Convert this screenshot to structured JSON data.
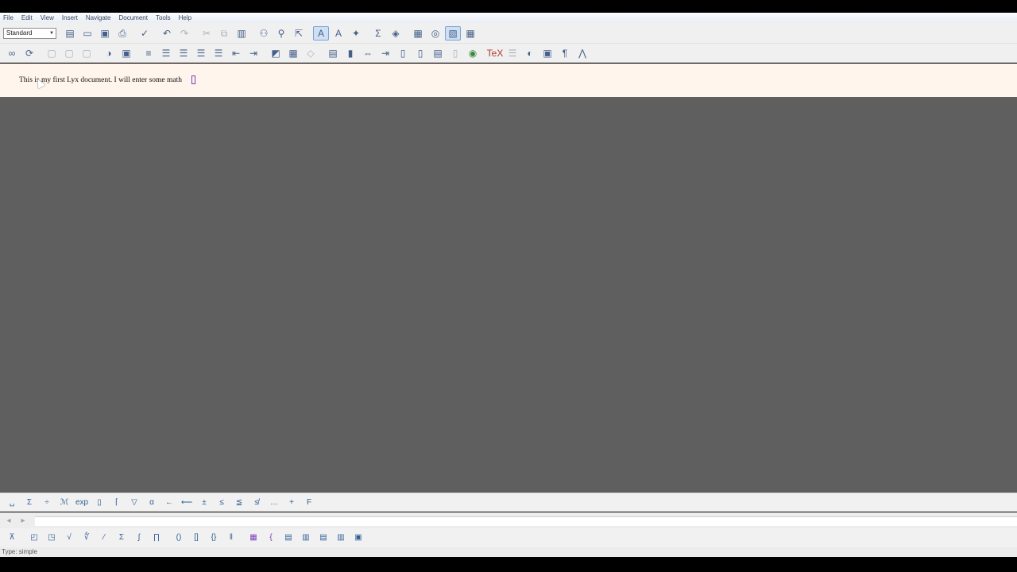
{
  "menubar": {
    "items": [
      "File",
      "Edit",
      "View",
      "Insert",
      "Navigate",
      "Document",
      "Tools",
      "Help"
    ]
  },
  "toolbar1": {
    "layout_select_value": "Standard",
    "icons": [
      {
        "name": "new-document-icon",
        "glyph": "▤"
      },
      {
        "name": "open-icon",
        "glyph": "▭"
      },
      {
        "name": "save-icon",
        "glyph": "▣"
      },
      {
        "name": "print-icon",
        "glyph": "⎙"
      },
      {
        "name": "spellcheck-icon",
        "glyph": "✓"
      },
      {
        "name": "undo-icon",
        "glyph": "↶"
      },
      {
        "name": "redo-icon",
        "glyph": "↷"
      },
      {
        "name": "cut-icon",
        "glyph": "✂"
      },
      {
        "name": "copy-icon",
        "glyph": "⧉"
      },
      {
        "name": "paste-icon",
        "glyph": "▥"
      },
      {
        "name": "find-replace-icon",
        "glyph": "⚇"
      },
      {
        "name": "search-icon",
        "glyph": "⚲"
      },
      {
        "name": "navigate-icon",
        "glyph": "⇱"
      },
      {
        "name": "text-style-icon",
        "glyph": "A"
      },
      {
        "name": "font-icon",
        "glyph": "A"
      },
      {
        "name": "emphasis-icon",
        "glyph": "✦"
      },
      {
        "name": "math-icon",
        "glyph": "Σ"
      },
      {
        "name": "insert-graphics-icon",
        "glyph": "◈"
      },
      {
        "name": "insert-table-icon",
        "glyph": "▦"
      },
      {
        "name": "view-source-icon",
        "glyph": "◎"
      },
      {
        "name": "toggle-math-toolbar-icon",
        "glyph": "▧"
      },
      {
        "name": "toggle-table-toolbar-icon",
        "glyph": "▦"
      }
    ]
  },
  "toolbar2": {
    "icons": [
      {
        "name": "view-icon",
        "glyph": "∞"
      },
      {
        "name": "update-icon",
        "glyph": "⟳"
      },
      {
        "name": "view-pdf-icon",
        "glyph": "▢"
      },
      {
        "name": "view-dvi-icon",
        "glyph": "▢"
      },
      {
        "name": "view-ps-icon",
        "glyph": "▢"
      },
      {
        "name": "change-tracking-icon",
        "glyph": "◑"
      },
      {
        "name": "review-icon",
        "glyph": "▣"
      },
      {
        "name": "align-default-icon",
        "glyph": "≡"
      },
      {
        "name": "itemize-icon",
        "glyph": "☰"
      },
      {
        "name": "enumerate-icon",
        "glyph": "☰"
      },
      {
        "name": "description-icon",
        "glyph": "☰"
      },
      {
        "name": "list-icon",
        "glyph": "☰"
      },
      {
        "name": "decrease-depth-icon",
        "glyph": "⇤"
      },
      {
        "name": "increase-depth-icon",
        "glyph": "⇥"
      },
      {
        "name": "insert-figure-icon",
        "glyph": "◩"
      },
      {
        "name": "insert-table-float-icon",
        "glyph": "▦"
      },
      {
        "name": "insert-label-icon",
        "glyph": "◇"
      },
      {
        "name": "insert-reference-icon",
        "glyph": "▤"
      },
      {
        "name": "insert-bookmark-icon",
        "glyph": "▮"
      },
      {
        "name": "insert-hyperlink-icon",
        "glyph": "⇔"
      },
      {
        "name": "insert-cross-ref-icon",
        "glyph": "⇥"
      },
      {
        "name": "insert-footnote-icon",
        "glyph": "▯"
      },
      {
        "name": "insert-margin-note-icon",
        "glyph": "▯"
      },
      {
        "name": "insert-note-icon",
        "glyph": "▤"
      },
      {
        "name": "insert-box-icon",
        "glyph": "▯"
      },
      {
        "name": "insert-url-icon",
        "glyph": "◉"
      },
      {
        "name": "insert-tex-code-icon",
        "glyph": "TeX"
      },
      {
        "name": "insert-index-icon",
        "glyph": "☰"
      },
      {
        "name": "insert-citation-icon",
        "glyph": "◐"
      },
      {
        "name": "insert-external-material-icon",
        "glyph": "▣"
      },
      {
        "name": "insert-glossary-icon",
        "glyph": "¶"
      },
      {
        "name": "insert-bibtex-icon",
        "glyph": "⋀"
      }
    ]
  },
  "document": {
    "text": "This is my first Lyx document. I will enter some math"
  },
  "mathbar1": {
    "icons": [
      {
        "name": "math-space-icon",
        "glyph": "␣"
      },
      {
        "name": "math-operators-icon",
        "glyph": "Σ"
      },
      {
        "name": "math-fraction-style-icon",
        "glyph": "÷"
      },
      {
        "name": "math-font-style-icon",
        "glyph": "ℳ"
      },
      {
        "name": "math-functions-icon",
        "glyph": "exp"
      },
      {
        "name": "math-frac-box-icon",
        "glyph": "▯"
      },
      {
        "name": "math-delimiters-icon",
        "glyph": "⌈"
      },
      {
        "name": "math-accents-icon",
        "glyph": "▽"
      },
      {
        "name": "math-greek-icon",
        "glyph": "α"
      },
      {
        "name": "math-arrows-icon",
        "glyph": "←"
      },
      {
        "name": "math-long-arrows-icon",
        "glyph": "⟵"
      },
      {
        "name": "math-binary-operators-icon",
        "glyph": "±"
      },
      {
        "name": "math-relations-icon",
        "glyph": "≤"
      },
      {
        "name": "math-relations-2-icon",
        "glyph": "≦"
      },
      {
        "name": "math-negations-icon",
        "glyph": "≰"
      },
      {
        "name": "math-dots-icon",
        "glyph": "…"
      },
      {
        "name": "math-misc-icon",
        "glyph": "+"
      },
      {
        "name": "math-font-symbol-icon",
        "glyph": "F"
      }
    ]
  },
  "navbar": {
    "icons": [
      {
        "name": "nav-back-icon",
        "glyph": "◂"
      },
      {
        "name": "nav-forward-icon",
        "glyph": "▸"
      }
    ]
  },
  "mathbar2": {
    "icons": [
      {
        "name": "math-display-icon",
        "glyph": "⊼"
      },
      {
        "name": "math-subscript-icon",
        "glyph": "◰"
      },
      {
        "name": "math-superscript-icon",
        "glyph": "◳"
      },
      {
        "name": "math-sqrt-icon",
        "glyph": "√"
      },
      {
        "name": "math-root-icon",
        "glyph": "∜"
      },
      {
        "name": "math-frac-icon",
        "glyph": "⁄"
      },
      {
        "name": "math-sum-icon",
        "glyph": "Σ"
      },
      {
        "name": "math-integral-icon",
        "glyph": "∫"
      },
      {
        "name": "math-product-icon",
        "glyph": "∏"
      },
      {
        "name": "math-parentheses-icon",
        "glyph": "()"
      },
      {
        "name": "math-brackets-icon",
        "glyph": "[]"
      },
      {
        "name": "math-braces-icon",
        "glyph": "{}"
      },
      {
        "name": "math-double-bars-icon",
        "glyph": "‖"
      },
      {
        "name": "math-matrix-icon",
        "glyph": "▦"
      },
      {
        "name": "math-cases-icon",
        "glyph": "{"
      },
      {
        "name": "math-add-row-icon",
        "glyph": "▤"
      },
      {
        "name": "math-add-column-icon",
        "glyph": "▥"
      },
      {
        "name": "math-delete-row-icon",
        "glyph": "▤"
      },
      {
        "name": "math-delete-column-icon",
        "glyph": "▥"
      },
      {
        "name": "math-panel-icon",
        "glyph": "▣"
      }
    ]
  },
  "status": {
    "text": "Type: simple"
  },
  "colors": {
    "workspace": "#5f5f5f",
    "document_background": "#fff5ec",
    "math_box": "#7a3fb8",
    "toolbar": "#f0f0f0"
  }
}
